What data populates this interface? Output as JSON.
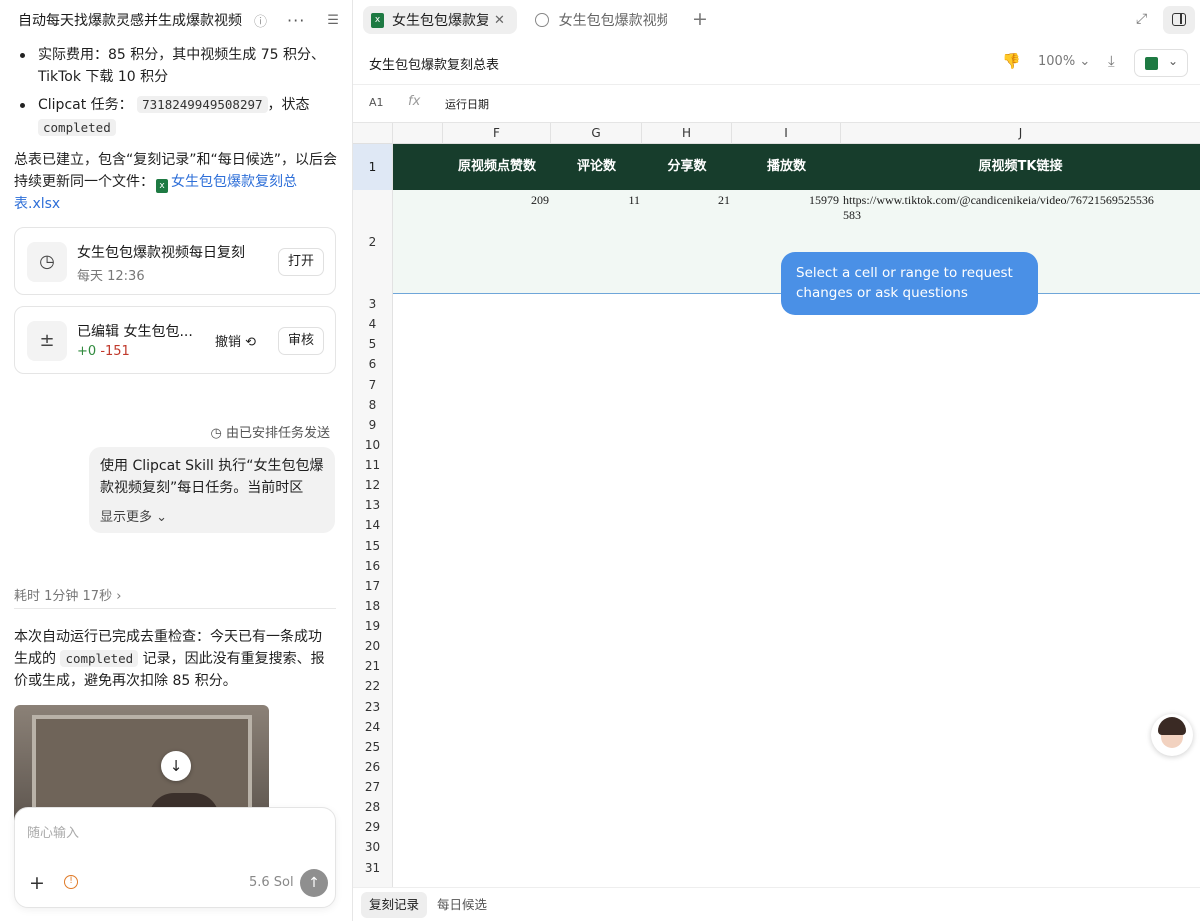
{
  "left": {
    "header": {
      "title": "自动每天找爆款灵感并生成爆款视频",
      "info_icon": "info-icon",
      "more_icon": "more-icon",
      "list_icon": "list-icon"
    },
    "bullets": [
      {
        "line1": "实际费用：85 积分，其中视频生成 75 积分、",
        "line2": "TikTok 下载 10 积分"
      },
      {
        "prefix": "Clipcat 任务：",
        "task_id": "7318249949508297",
        "mid": "，状态",
        "status": "completed"
      }
    ],
    "summary": {
      "line1": "总表已建立，包含“复刻记录”和“每日候选”，以后会",
      "line2_prefix": "持续更新同一个文件：",
      "link_part1": "女生包包爆款复刻总",
      "link_part2": "表.xlsx"
    },
    "cards": [
      {
        "title": "女生包包爆款视频每日复刻",
        "subtitle": "每天 12:36",
        "button": "打开"
      },
      {
        "title": "已编辑 女生包包...",
        "added": "+0",
        "removed": "-151",
        "undo": "撤销 ⟲",
        "button": "审核"
      }
    ],
    "scheduled_label": "由已安排任务发送",
    "user_message": {
      "line1": "使用 Clipcat Skill 执行“女生包包爆",
      "line2": "款视频复刻”每日任务。当前时区",
      "show_more": "显示更多"
    },
    "elapsed": "耗时 1分钟 17秒",
    "result": {
      "line1": "本次自动运行已完成去重检查：今天已有一条成功",
      "line2_prefix": "生成的",
      "code": "completed",
      "line2_suffix": "记录，因此没有重复搜索、报",
      "line3": "价或生成，避免再次扣除 85 积分。"
    },
    "input": {
      "placeholder": "随心输入",
      "cost": "5.6 Sol"
    }
  },
  "right": {
    "tabs": [
      {
        "label": "女生包包爆款复刻",
        "active": true
      },
      {
        "label": "女生包包爆款视频每",
        "active": false
      }
    ],
    "doc_title": "女生包包爆款复刻总表",
    "zoom": "100%",
    "formula": {
      "cell_ref": "A1",
      "fx": "fx",
      "value": "运行日期"
    },
    "columns": [
      "F",
      "G",
      "H",
      "I",
      "J"
    ],
    "header_row": [
      "原视频点赞数",
      "评论数",
      "分享数",
      "播放数",
      "原视频TK链接"
    ],
    "data_row": {
      "F": "209",
      "G": "11",
      "H": "21",
      "I": "15979",
      "J_line1": "https://www.tiktok.com/@candicenikeia/video/76721569525536",
      "J_line2": "583"
    },
    "row_numbers": [
      "1",
      "2",
      "3",
      "4",
      "5",
      "6",
      "7",
      "8",
      "9",
      "10",
      "11",
      "12",
      "13",
      "14",
      "15",
      "16",
      "17",
      "18",
      "19",
      "20",
      "21",
      "22",
      "23",
      "24",
      "25",
      "26",
      "27",
      "28",
      "29",
      "30",
      "31"
    ],
    "tooltip": {
      "line1": "Select a cell or range to request",
      "line2": "changes or ask questions"
    },
    "sheet_tabs": [
      "复刻记录",
      "每日候选"
    ],
    "colors": {
      "header_bg": "#173d2c",
      "tooltip_bg": "#4a90e6",
      "excel_green": "#1e7a43"
    }
  }
}
